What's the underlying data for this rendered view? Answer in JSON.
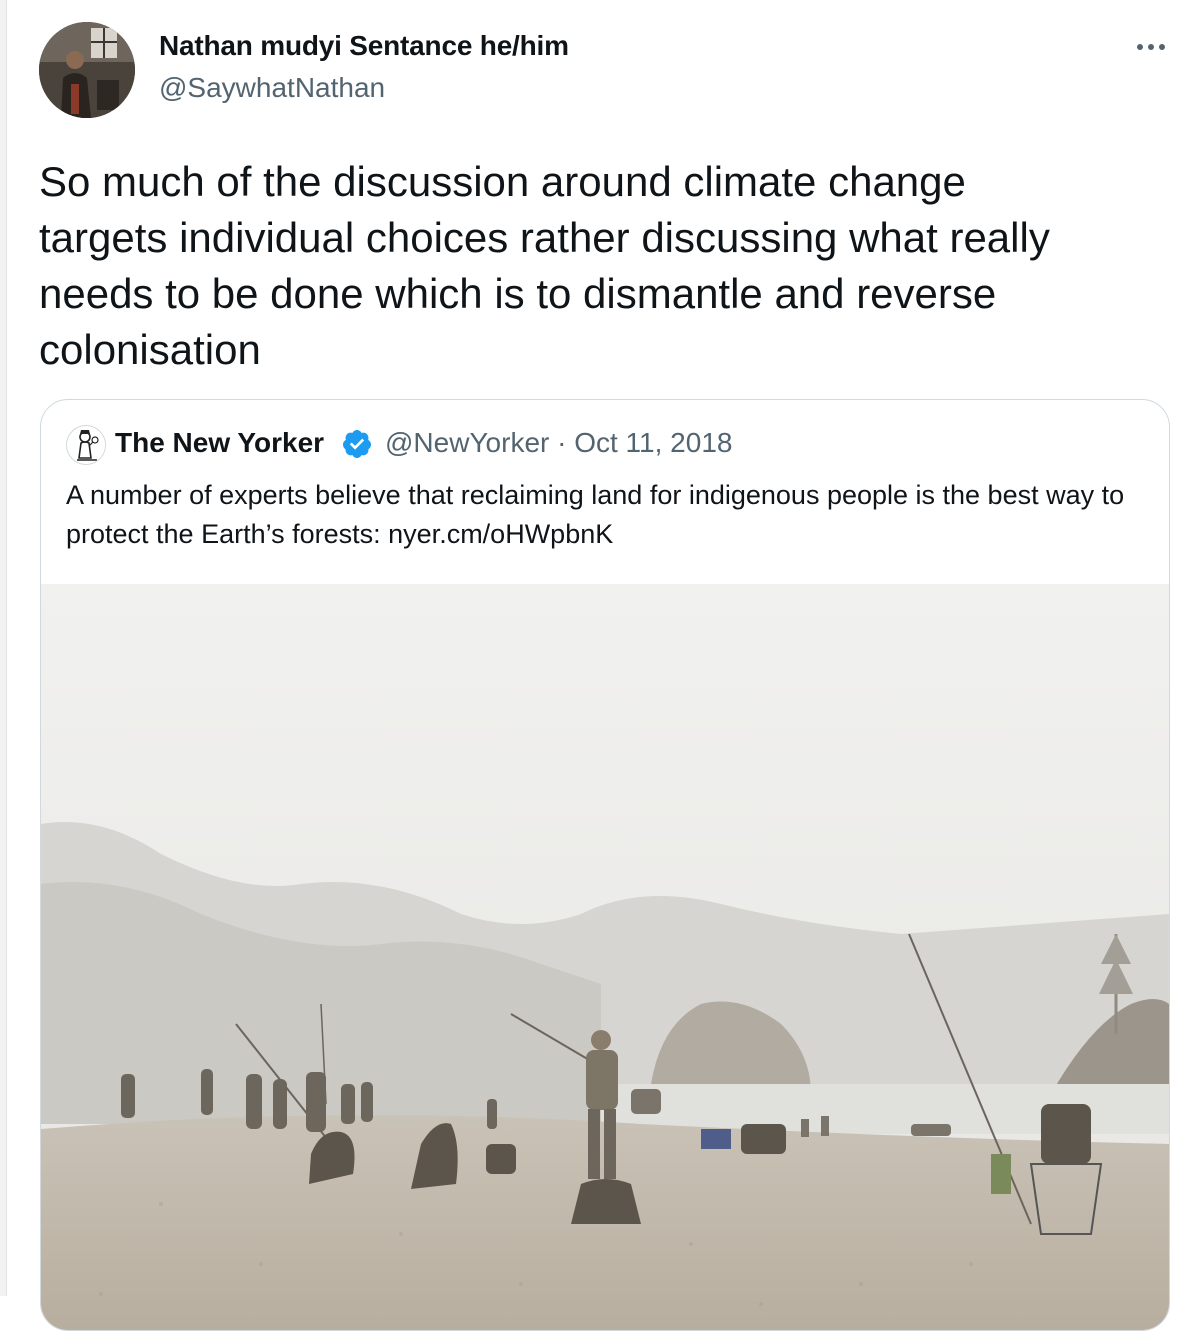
{
  "author": {
    "name": "Nathan mudyi Sentance he/him",
    "handle": "@SaywhatNathan",
    "avatar_icon": "profile-photo"
  },
  "tweet": {
    "text": "So much of the discussion around climate change\ntargets individual choices rather discussing what really\nneeds to be done which is to dismantle and reverse\ncolonisation",
    "more_icon": "more-horizontal-icon"
  },
  "quoted": {
    "name": "The New Yorker",
    "handle_date": "@NewYorker · Oct 11, 2018",
    "text": "A number of experts believe that reclaiming land for indigenous people is the best way to protect the Earth’s forests: nyer.cm/oHWpbnK",
    "verified_color": "#1d9bf0",
    "media_icon": "beach-fishing-photo"
  },
  "colors": {
    "text_primary": "#0f1419",
    "text_secondary": "#536471",
    "border": "#cfd9de",
    "accent": "#1d9bf0"
  }
}
